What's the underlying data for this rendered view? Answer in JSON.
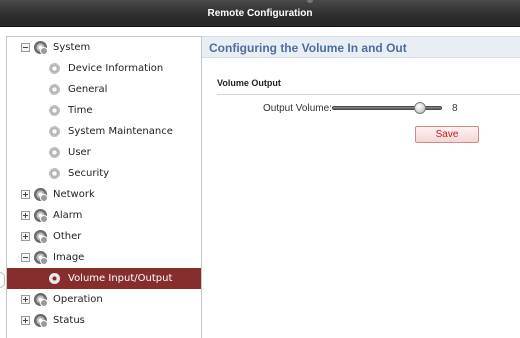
{
  "window": {
    "title": "Remote Configuration"
  },
  "sidebar": {
    "items": [
      {
        "label": "System",
        "level": 0,
        "expanded": true,
        "toggle": "minus"
      },
      {
        "label": "Device Information",
        "level": 1
      },
      {
        "label": "General",
        "level": 1
      },
      {
        "label": "Time",
        "level": 1
      },
      {
        "label": "System Maintenance",
        "level": 1
      },
      {
        "label": "User",
        "level": 1
      },
      {
        "label": "Security",
        "level": 1
      },
      {
        "label": "Network",
        "level": 0,
        "expanded": false,
        "toggle": "plus"
      },
      {
        "label": "Alarm",
        "level": 0,
        "expanded": false,
        "toggle": "plus"
      },
      {
        "label": "Other",
        "level": 0,
        "expanded": false,
        "toggle": "plus"
      },
      {
        "label": "Image",
        "level": 0,
        "expanded": true,
        "toggle": "minus"
      },
      {
        "label": "Volume Input/Output",
        "level": 1,
        "selected": true
      },
      {
        "label": "Operation",
        "level": 0,
        "expanded": false,
        "toggle": "plus"
      },
      {
        "label": "Status",
        "level": 0,
        "expanded": false,
        "toggle": "plus"
      }
    ]
  },
  "main": {
    "header_title": "Configuring the Volume In and Out",
    "section_title": "Volume Output",
    "output_volume": {
      "label": "Output Volume:",
      "value": "8",
      "fraction": 0.8
    },
    "save_label": "Save"
  },
  "colors": {
    "titlebar": "#2f2f2f",
    "selected_row": "#862d2d",
    "header_text": "#4e6e9a",
    "save_text": "#c02020"
  }
}
